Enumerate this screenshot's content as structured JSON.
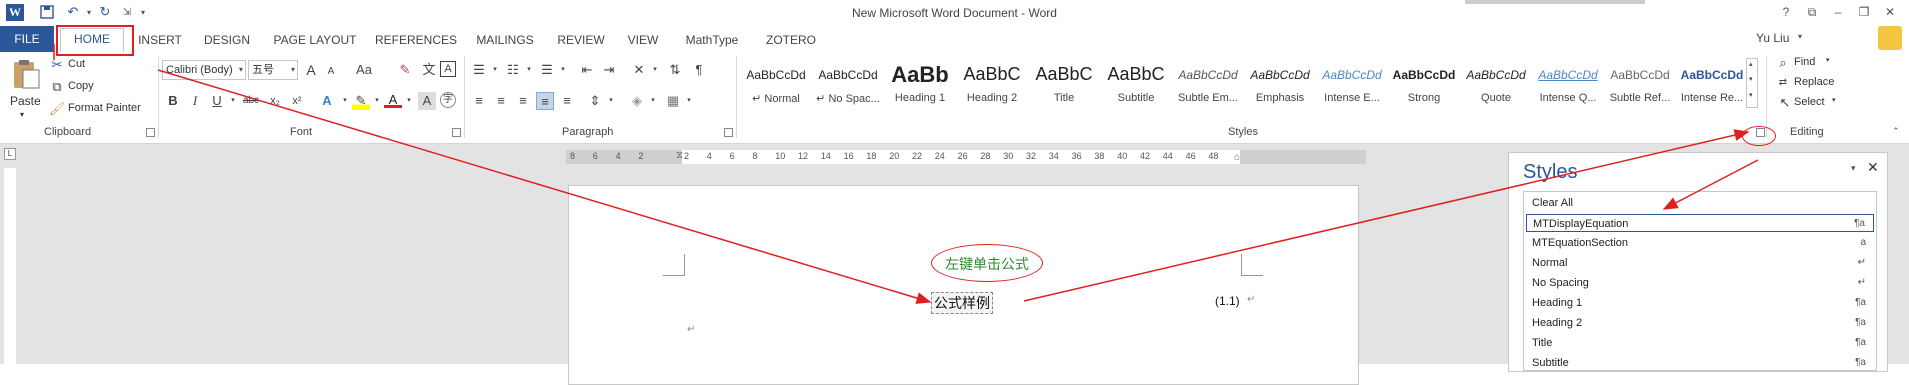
{
  "window": {
    "title": "New Microsoft Word Document - Word",
    "help": "?",
    "ribbon_display": "⧉",
    "minimize": "–",
    "restore": "❐",
    "close": "✕",
    "user": "Yu Liu",
    "user_arrow": "▾"
  },
  "qat": {
    "save_icon": "save-icon",
    "undo_icon": "undo-icon",
    "redo_icon": "redo-icon",
    "more_icon": "customize-icon"
  },
  "tabs": [
    "FILE",
    "HOME",
    "INSERT",
    "DESIGN",
    "PAGE LAYOUT",
    "REFERENCES",
    "MAILINGS",
    "REVIEW",
    "VIEW",
    "MathType",
    "ZOTERO"
  ],
  "clipboard": {
    "paste": "Paste",
    "cut": "Cut",
    "copy": "Copy",
    "format_painter": "Format Painter",
    "label": "Clipboard"
  },
  "font": {
    "name": "Calibri (Body)",
    "size": "五号",
    "label": "Font",
    "bold": "B",
    "italic": "I",
    "underline": "U",
    "strike": "abc",
    "subscript": "x₂",
    "superscript": "x²",
    "grow": "A",
    "shrink": "A",
    "case": "Aa",
    "text_effect": "A",
    "font_color": "A",
    "char_border": "A"
  },
  "paragraph": {
    "label": "Paragraph"
  },
  "styles": {
    "label": "Styles",
    "gallery": [
      {
        "sample": "AaBbCcDd",
        "name": "↵ Normal"
      },
      {
        "sample": "AaBbCcDd",
        "name": "↵ No Spac..."
      },
      {
        "sample": "AaBb",
        "name": "Heading 1"
      },
      {
        "sample": "AaBbC",
        "name": "Heading 2"
      },
      {
        "sample": "AaBbC",
        "name": "Title"
      },
      {
        "sample": "AaBbC",
        "name": "Subtitle"
      },
      {
        "sample": "AaBbCcDd",
        "name": "Subtle Em..."
      },
      {
        "sample": "AaBbCcDd",
        "name": "Emphasis"
      },
      {
        "sample": "AaBbCcDd",
        "name": "Intense E..."
      },
      {
        "sample": "AaBbCcDd",
        "name": "Strong"
      },
      {
        "sample": "AaBbCcDd",
        "name": "Quote"
      },
      {
        "sample": "AaBbCcDd",
        "name": "Intense Q..."
      },
      {
        "sample": "AaBbCcDd",
        "name": "Subtle Ref..."
      },
      {
        "sample": "AaBbCcDd",
        "name": "Intense Re..."
      }
    ]
  },
  "editing": {
    "label": "Editing",
    "find": "Find",
    "replace": "Replace",
    "select": "Select"
  },
  "ruler": {
    "numbers": [
      "8",
      "6",
      "4",
      "2",
      "",
      "2",
      "4",
      "6",
      "8",
      "10",
      "12",
      "14",
      "16",
      "18",
      "20",
      "22",
      "24",
      "26",
      "28",
      "30",
      "32",
      "34",
      "36",
      "38",
      "40",
      "42",
      "44",
      "46",
      "48"
    ]
  },
  "document": {
    "formula_text": "公式样例",
    "equation_number": "(1.1)",
    "para_mark": "↵",
    "annotation": "左键单击公式"
  },
  "styles_pane": {
    "title": "Styles",
    "items": [
      {
        "name": "Clear All",
        "sym": ""
      },
      {
        "name": "MTDisplayEquation",
        "sym": "¶a"
      },
      {
        "name": "MTEquationSection",
        "sym": "a"
      },
      {
        "name": "Normal",
        "sym": "↵"
      },
      {
        "name": "No Spacing",
        "sym": "↵"
      },
      {
        "name": "Heading 1",
        "sym": "¶a"
      },
      {
        "name": "Heading 2",
        "sym": "¶a"
      },
      {
        "name": "Title",
        "sym": "¶a"
      },
      {
        "name": "Subtitle",
        "sym": "¶a"
      }
    ]
  },
  "colors": {
    "accent": "#2b579a",
    "annotation_red": "#e02020",
    "annotation_text": "#2e8b2e"
  }
}
